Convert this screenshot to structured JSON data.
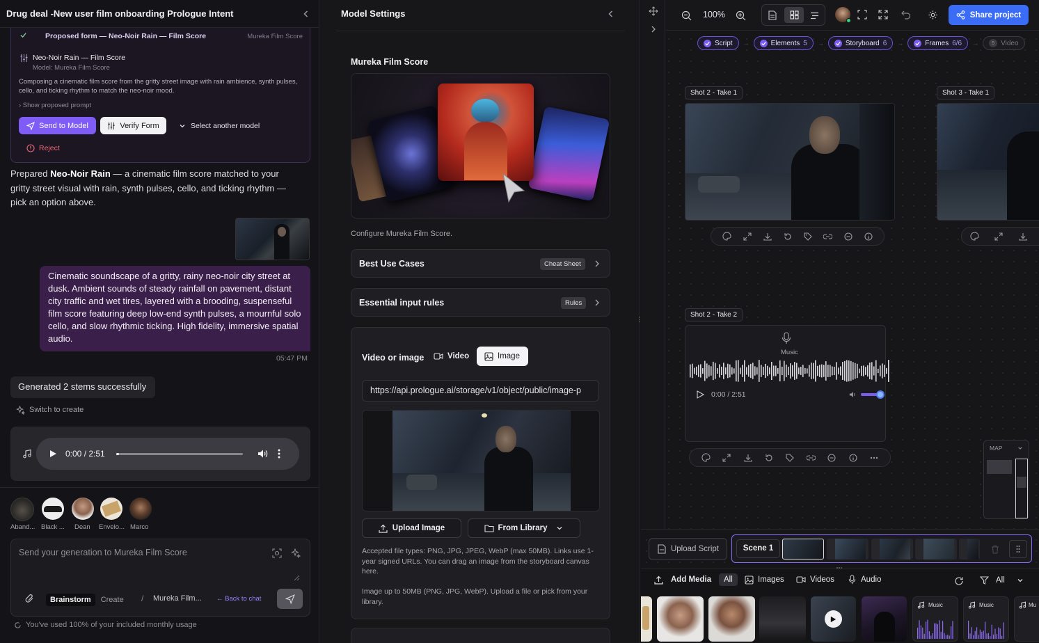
{
  "left": {
    "title": "Drug deal -New user film onboarding Prologue Intent",
    "form": {
      "header_label": "Proposed form — Neo-Noir Rain — Film Score",
      "header_model": "Mureka Film Score",
      "item_title": "Neo-Noir Rain — Film Score",
      "item_model": "Model: Mureka Film Score",
      "description": "Composing a cinematic film score from the gritty street image with rain ambience, synth pulses, cello, and ticking rhythm to match the neo-noir mood.",
      "show_prompt": "› Show proposed prompt",
      "send_label": "Send to Model",
      "verify_label": "Verify Form",
      "select_label": "Select another model",
      "reject_label": "Reject"
    },
    "assistant_msg_pre": "Prepared ",
    "assistant_msg_bold": "Neo-Noir Rain",
    "assistant_msg_post": " — a cinematic film score matched to your gritty street visual with rain, synth pulses, cello, and ticking rhythm — pick an option above.",
    "user_msg": "Cinematic soundscape of a gritty, rainy neo-noir city street at dusk. Ambient sounds of steady rainfall on pavement, distant city traffic and wet tires, layered with a brooding, suspenseful film score featuring deep low-end synth pulses, a mournful solo cello, and slow rhythmic ticking. High fidelity, immersive spatial audio.",
    "user_time": "05:47 PM",
    "status_msg": "Generated 2 stems successfully",
    "switch_label": "Switch to create",
    "audio_time": "0:00 / 2:51",
    "avatars": [
      {
        "label": "Aband..."
      },
      {
        "label": "Black ..."
      },
      {
        "label": "Dean"
      },
      {
        "label": "Envelo..."
      },
      {
        "label": "Marco"
      }
    ],
    "composer_placeholder": "Send your generation to Mureka Film Score",
    "mode_brainstorm": "Brainstorm",
    "mode_create": "Create",
    "slash": "/",
    "model_short": "Mureka Film...",
    "back_label": "← Back to chat",
    "usage": "You've used 100% of your included monthly usage"
  },
  "mid": {
    "title": "Model Settings",
    "model_name": "Mureka Film Score",
    "configure": "Configure Mureka Film Score.",
    "best_use": "Best Use Cases",
    "cheat_sheet": "Cheat Sheet",
    "rules_title": "Essential input rules",
    "rules_tag": "Rules",
    "video_or_image": "Video or image",
    "tab_video": "Video",
    "tab_image": "Image",
    "url": "https://api.prologue.ai/storage/v1/object/public/image-p",
    "upload_image": "Upload Image",
    "from_library": "From Library",
    "accepted": "Accepted file types: PNG, JPG, JPEG, WebP (max 50MB). Links use 1-year signed URLs. You can drag an image from the storyboard canvas here.",
    "image_hint": "Image up to 50MB (PNG, JPG, WebP). Upload a file or pick from your library."
  },
  "right": {
    "zoom": "100%",
    "share": "Share project",
    "steps": [
      {
        "label": "Script",
        "count": ""
      },
      {
        "label": "Elements",
        "count": "5"
      },
      {
        "label": "Storyboard",
        "count": "6"
      },
      {
        "label": "Frames",
        "count": "6/6"
      },
      {
        "label": "Video",
        "count": "5"
      }
    ],
    "shot_a": "Shot 2 - Take 1",
    "shot_b": "Shot 3 - Take 1",
    "shot_c": "Shot 2 - Take 2",
    "music_label": "Music",
    "music_time": "0:00 / 2:51",
    "map": "MAP",
    "upload_script": "Upload Script",
    "scene": "Scene 1",
    "add_media": "Add Media",
    "filter_all": "All",
    "filter_images": "Images",
    "filter_videos": "Videos",
    "filter_audio": "Audio",
    "filter_menu": "All",
    "media_music_1": "Music",
    "media_music_2": "Music",
    "media_music_3": "Mu"
  },
  "colors": {
    "accent": "#7b5cf0",
    "share_blue": "#3b6cf6",
    "user_bubble": "#3a1f4a"
  }
}
